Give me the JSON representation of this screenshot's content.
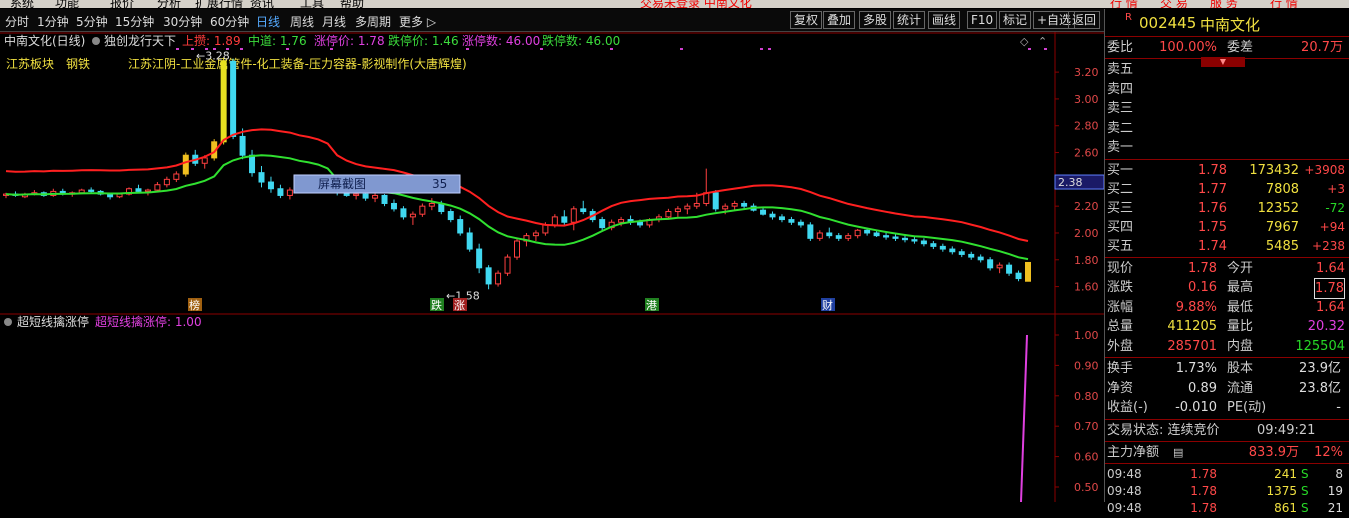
{
  "sys_menu": [
    "系统",
    "功能",
    "报价",
    "分析",
    "扩展行情",
    "资讯",
    "工具",
    "帮助"
  ],
  "sys_title": "交易未登录 中南文化",
  "sys_right": [
    "行 情",
    "交 易",
    "服 务",
    "行 情"
  ],
  "periods": [
    "分时",
    "1分钟",
    "5分钟",
    "15分钟",
    "30分钟",
    "60分钟",
    "日线",
    "周线",
    "月线",
    "多周期",
    "更多 ▷"
  ],
  "active_period": "日线",
  "tools": [
    "复权",
    "叠加",
    "多股",
    "统计",
    "画线",
    "F10",
    "标记",
    "+自选",
    "返回"
  ],
  "main": {
    "title": "中南文化(日线)",
    "indicator": "独创龙行天下",
    "params": [
      {
        "label": "上攒: 1.89",
        "color": "#ff3b3b"
      },
      {
        "label": "中道: 1.76",
        "color": "#3cdc3c"
      },
      {
        "label": "涨停价: 1.78",
        "color": "#e040e0"
      },
      {
        "label": "跌停价: 1.46",
        "color": "#3cdc3c"
      },
      {
        "label": "涨停数: 46.00",
        "color": "#e040e0"
      },
      {
        "label": "跌停数: 46.00",
        "color": "#3cdc3c"
      }
    ],
    "sectors": [
      "江苏板块",
      "钢铁",
      "江苏江阴-工业金属管件-化工装备-压力容器-影视制作(大唐辉煌)"
    ],
    "y_ticks": [
      "3.20",
      "3.00",
      "2.80",
      "2.60",
      "2.40",
      "2.20",
      "2.00",
      "1.80",
      "1.60"
    ],
    "price_marker": "2.38",
    "high_label": "3.28",
    "low_label": "1.58",
    "tooltip_label": "屏幕截图",
    "tooltip_value": "35",
    "event_tags": [
      "榜",
      "跌",
      "涨",
      "港",
      "财"
    ]
  },
  "sub": {
    "title": "超短线擒涨停",
    "param": "超短线擒涨停: 1.00",
    "y_ticks": [
      "1.00",
      "0.90",
      "0.80",
      "0.70",
      "0.60",
      "0.50"
    ]
  },
  "quote": {
    "code": "002445",
    "name": "中南文化",
    "weibi_label": "委比",
    "weibi": "100.00%",
    "weicha_label": "委差",
    "weicha": "20.7万",
    "sells": [
      "卖五",
      "卖四",
      "卖三",
      "卖二",
      "卖一"
    ],
    "buys": [
      {
        "label": "买一",
        "price": "1.78",
        "vol": "173432",
        "chg": "+3908"
      },
      {
        "label": "买二",
        "price": "1.77",
        "vol": "7808",
        "chg": "+3"
      },
      {
        "label": "买三",
        "price": "1.76",
        "vol": "12352",
        "chg": "-72"
      },
      {
        "label": "买四",
        "price": "1.75",
        "vol": "7967",
        "chg": "+94"
      },
      {
        "label": "买五",
        "price": "1.74",
        "vol": "5485",
        "chg": "+238"
      }
    ],
    "stats": [
      {
        "l1": "现价",
        "v1": "1.78",
        "c1": "red",
        "l2": "今开",
        "v2": "1.64",
        "c2": "red"
      },
      {
        "l1": "涨跌",
        "v1": "0.16",
        "c1": "red",
        "l2": "最高",
        "v2": "1.78",
        "c2": "red"
      },
      {
        "l1": "涨幅",
        "v1": "9.88%",
        "c1": "red",
        "l2": "最低",
        "v2": "1.64",
        "c2": "red"
      },
      {
        "l1": "总量",
        "v1": "411205",
        "c1": "yellow",
        "l2": "量比",
        "v2": "20.32",
        "c2": "magenta"
      },
      {
        "l1": "外盘",
        "v1": "285701",
        "c1": "red",
        "l2": "内盘",
        "v2": "125504",
        "c2": "green"
      }
    ],
    "stats2": [
      {
        "l1": "换手",
        "v1": "1.73%",
        "l2": "股本",
        "v2": "23.9亿"
      },
      {
        "l1": "净资",
        "v1": "0.89",
        "l2": "流通",
        "v2": "23.8亿"
      },
      {
        "l1": "收益(-)",
        "v1": "-0.010",
        "l2": "PE(动)",
        "v2": "-"
      }
    ],
    "trade_status": "交易状态: 连续竞价",
    "trade_time": "09:49:21",
    "main_net_label": "主力净额",
    "main_net": "833.9万",
    "main_net_pct": "12%",
    "ticks": [
      {
        "t": "09:48",
        "p": "1.78",
        "v": "241",
        "s": "S",
        "n": "8"
      },
      {
        "t": "09:48",
        "p": "1.78",
        "v": "1375",
        "s": "S",
        "n": "19"
      },
      {
        "t": "09:48",
        "p": "1.78",
        "v": "861",
        "s": "S",
        "n": "21"
      }
    ]
  },
  "chart_data": {
    "type": "candlestick",
    "y_range": [
      1.5,
      3.35
    ],
    "ohlc": [
      [
        2.28,
        2.3,
        2.26,
        2.29
      ],
      [
        2.29,
        2.31,
        2.27,
        2.28
      ],
      [
        2.27,
        2.3,
        2.26,
        2.29
      ],
      [
        2.29,
        2.32,
        2.28,
        2.3
      ],
      [
        2.3,
        2.31,
        2.27,
        2.28
      ],
      [
        2.28,
        2.33,
        2.27,
        2.31
      ],
      [
        2.31,
        2.33,
        2.28,
        2.29
      ],
      [
        2.29,
        2.31,
        2.27,
        2.3
      ],
      [
        2.3,
        2.33,
        2.29,
        2.32
      ],
      [
        2.32,
        2.34,
        2.3,
        2.31
      ],
      [
        2.31,
        2.32,
        2.28,
        2.29
      ],
      [
        2.29,
        2.3,
        2.25,
        2.27
      ],
      [
        2.27,
        2.3,
        2.26,
        2.29
      ],
      [
        2.29,
        2.34,
        2.28,
        2.33
      ],
      [
        2.33,
        2.36,
        2.3,
        2.31
      ],
      [
        2.31,
        2.33,
        2.28,
        2.32
      ],
      [
        2.32,
        2.38,
        2.31,
        2.36
      ],
      [
        2.36,
        2.42,
        2.34,
        2.4
      ],
      [
        2.4,
        2.46,
        2.38,
        2.44
      ],
      [
        2.44,
        2.6,
        2.42,
        2.58
      ],
      [
        2.58,
        2.62,
        2.5,
        2.52
      ],
      [
        2.52,
        2.58,
        2.48,
        2.56
      ],
      [
        2.56,
        2.7,
        2.54,
        2.68
      ],
      [
        2.68,
        3.31,
        2.66,
        3.28
      ],
      [
        3.28,
        3.3,
        2.7,
        2.72
      ],
      [
        2.72,
        2.78,
        2.55,
        2.58
      ],
      [
        2.58,
        2.62,
        2.42,
        2.45
      ],
      [
        2.45,
        2.5,
        2.34,
        2.38
      ],
      [
        2.38,
        2.42,
        2.3,
        2.33
      ],
      [
        2.33,
        2.36,
        2.26,
        2.28
      ],
      [
        2.28,
        2.34,
        2.25,
        2.32
      ],
      [
        2.32,
        2.38,
        2.3,
        2.36
      ],
      [
        2.36,
        2.4,
        2.33,
        2.38
      ],
      [
        2.38,
        2.41,
        2.34,
        2.36
      ],
      [
        2.36,
        2.38,
        2.31,
        2.33
      ],
      [
        2.33,
        2.35,
        2.28,
        2.3
      ],
      [
        2.3,
        2.33,
        2.27,
        2.28
      ],
      [
        2.28,
        2.31,
        2.25,
        2.29
      ],
      [
        2.29,
        2.31,
        2.24,
        2.26
      ],
      [
        2.26,
        2.3,
        2.23,
        2.28
      ],
      [
        2.28,
        2.29,
        2.2,
        2.22
      ],
      [
        2.22,
        2.25,
        2.16,
        2.18
      ],
      [
        2.18,
        2.2,
        2.1,
        2.12
      ],
      [
        2.12,
        2.16,
        2.06,
        2.14
      ],
      [
        2.14,
        2.22,
        2.12,
        2.2
      ],
      [
        2.2,
        2.26,
        2.17,
        2.22
      ],
      [
        2.22,
        2.24,
        2.14,
        2.16
      ],
      [
        2.16,
        2.18,
        2.08,
        2.1
      ],
      [
        2.1,
        2.13,
        1.98,
        2.0
      ],
      [
        2.0,
        2.04,
        1.86,
        1.88
      ],
      [
        1.88,
        1.92,
        1.7,
        1.74
      ],
      [
        1.74,
        1.76,
        1.58,
        1.62
      ],
      [
        1.62,
        1.72,
        1.6,
        1.7
      ],
      [
        1.7,
        1.84,
        1.68,
        1.82
      ],
      [
        1.82,
        1.96,
        1.8,
        1.94
      ],
      [
        1.94,
        2.0,
        1.9,
        1.98
      ],
      [
        1.98,
        2.02,
        1.94,
        2.0
      ],
      [
        2.0,
        2.08,
        1.98,
        2.06
      ],
      [
        2.06,
        2.14,
        2.04,
        2.12
      ],
      [
        2.12,
        2.17,
        2.06,
        2.08
      ],
      [
        2.08,
        2.2,
        2.02,
        2.18
      ],
      [
        2.18,
        2.24,
        2.14,
        2.16
      ],
      [
        2.16,
        2.18,
        2.08,
        2.1
      ],
      [
        2.1,
        2.12,
        2.02,
        2.04
      ],
      [
        2.04,
        2.1,
        2.02,
        2.08
      ],
      [
        2.08,
        2.12,
        2.05,
        2.1
      ],
      [
        2.1,
        2.13,
        2.06,
        2.08
      ],
      [
        2.08,
        2.1,
        2.04,
        2.06
      ],
      [
        2.06,
        2.11,
        2.04,
        2.1
      ],
      [
        2.1,
        2.14,
        2.08,
        2.12
      ],
      [
        2.12,
        2.18,
        2.1,
        2.16
      ],
      [
        2.16,
        2.2,
        2.12,
        2.18
      ],
      [
        2.18,
        2.22,
        2.14,
        2.2
      ],
      [
        2.2,
        2.3,
        2.18,
        2.22
      ],
      [
        2.22,
        2.48,
        2.2,
        2.3
      ],
      [
        2.3,
        2.32,
        2.16,
        2.18
      ],
      [
        2.18,
        2.22,
        2.14,
        2.2
      ],
      [
        2.2,
        2.24,
        2.17,
        2.22
      ],
      [
        2.22,
        2.24,
        2.18,
        2.2
      ],
      [
        2.2,
        2.22,
        2.16,
        2.17
      ],
      [
        2.17,
        2.19,
        2.13,
        2.14
      ],
      [
        2.14,
        2.16,
        2.1,
        2.12
      ],
      [
        2.12,
        2.14,
        2.08,
        2.1
      ],
      [
        2.1,
        2.12,
        2.06,
        2.08
      ],
      [
        2.08,
        2.1,
        2.04,
        2.06
      ],
      [
        2.06,
        2.08,
        1.94,
        1.96
      ],
      [
        1.96,
        2.02,
        1.94,
        2.0
      ],
      [
        2.0,
        2.04,
        1.96,
        1.98
      ],
      [
        1.98,
        2.0,
        1.94,
        1.96
      ],
      [
        1.96,
        2.0,
        1.94,
        1.98
      ],
      [
        1.98,
        2.03,
        1.96,
        2.02
      ],
      [
        2.02,
        2.04,
        1.98,
        2.0
      ],
      [
        2.0,
        2.02,
        1.97,
        1.98
      ],
      [
        1.98,
        2.0,
        1.95,
        1.97
      ],
      [
        1.97,
        1.99,
        1.94,
        1.96
      ],
      [
        1.96,
        1.98,
        1.93,
        1.95
      ],
      [
        1.95,
        1.97,
        1.92,
        1.94
      ],
      [
        1.94,
        1.96,
        1.9,
        1.92
      ],
      [
        1.92,
        1.94,
        1.88,
        1.9
      ],
      [
        1.9,
        1.92,
        1.86,
        1.88
      ],
      [
        1.88,
        1.9,
        1.84,
        1.86
      ],
      [
        1.86,
        1.88,
        1.82,
        1.84
      ],
      [
        1.84,
        1.86,
        1.8,
        1.82
      ],
      [
        1.82,
        1.84,
        1.78,
        1.8
      ],
      [
        1.8,
        1.82,
        1.72,
        1.74
      ],
      [
        1.74,
        1.78,
        1.7,
        1.76
      ],
      [
        1.76,
        1.78,
        1.68,
        1.7
      ],
      [
        1.7,
        1.72,
        1.64,
        1.66
      ],
      [
        1.64,
        1.78,
        1.64,
        1.78
      ]
    ]
  }
}
